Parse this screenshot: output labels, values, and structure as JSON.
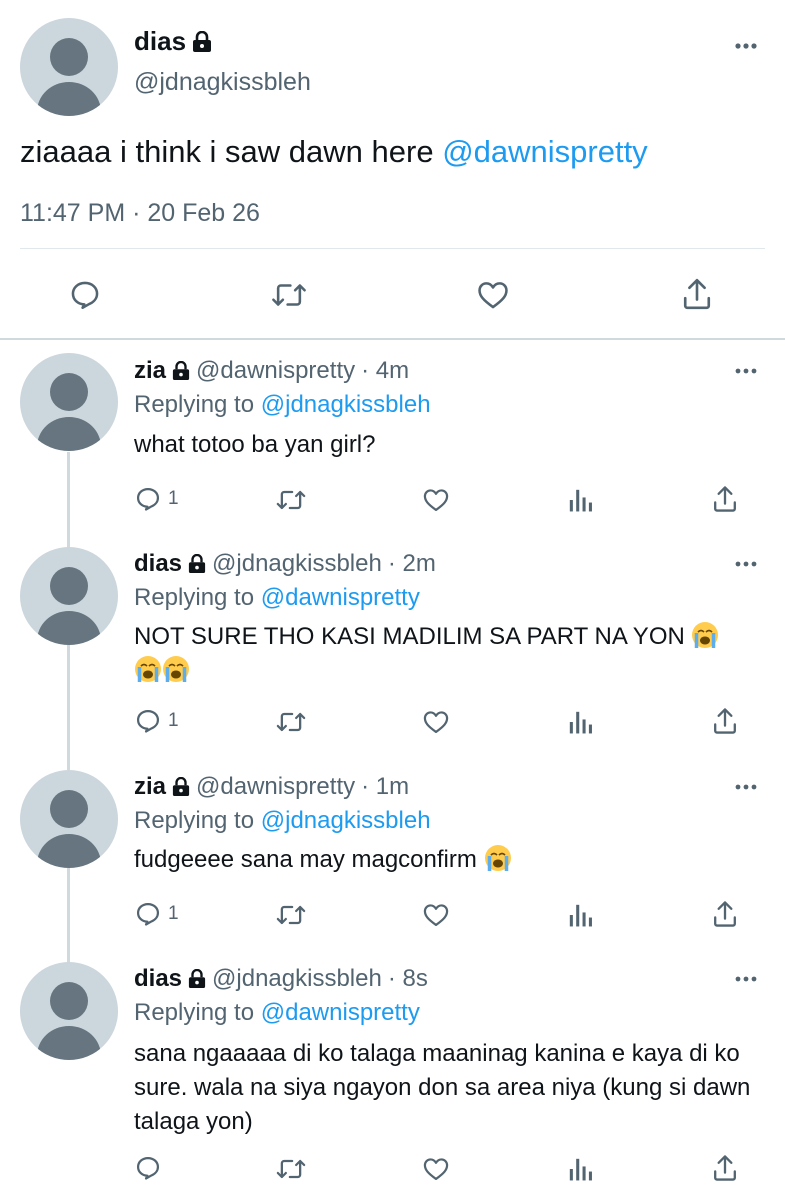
{
  "main_tweet": {
    "name": "dias",
    "handle": "@jdnagkissbleh",
    "text": "ziaaaa i think i saw dawn here ",
    "mention": "@dawnispretty",
    "timestamp": "11:47 PM · 20 Feb 26",
    "icons": [
      "reply-icon",
      "retweet-icon",
      "like-icon",
      "share-icon"
    ]
  },
  "replies": [
    {
      "name": "zia",
      "handle": "@dawnispretty",
      "time": "· 4m",
      "replying_prefix": "Replying to ",
      "replying_to": "@jdnagkissbleh",
      "text": "what totoo ba yan girl?",
      "reply_count": "1"
    },
    {
      "name": "dias",
      "handle": "@jdnagkissbleh",
      "time": "· 2m",
      "replying_prefix": "Replying to ",
      "replying_to": "@dawnispretty",
      "text": "NOT SURE THO KASI MADILIM SA PART NA YON ",
      "reply_count": "1"
    },
    {
      "name": "zia",
      "handle": "@dawnispretty",
      "time": "· 1m",
      "replying_prefix": "Replying to ",
      "replying_to": "@jdnagkissbleh",
      "text": "fudgeeee sana may magconfirm ",
      "reply_count": "1"
    },
    {
      "name": "dias",
      "handle": "@jdnagkissbleh",
      "time": "· 8s",
      "replying_prefix": "Replying to ",
      "replying_to": "@dawnispretty",
      "text": "sana ngaaaaa di ko talaga maaninag kanina e kaya di ko sure. wala na siya ngayon don sa area niya (kung si dawn talaga yon)",
      "reply_count": ""
    }
  ],
  "colors": {
    "accent": "#1d9bf0",
    "secondary_text": "#536471",
    "avatar_bg": "#ccd6dd",
    "avatar_fg": "#66757f"
  }
}
